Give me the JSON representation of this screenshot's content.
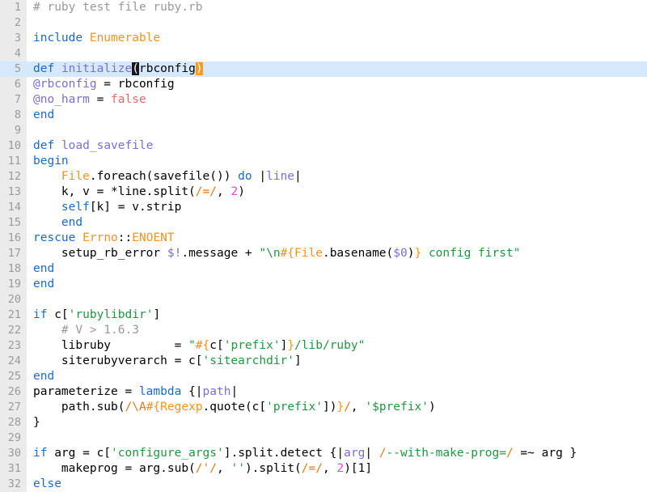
{
  "editor": {
    "language": "ruby",
    "filename": "ruby.rb",
    "current_line": 5,
    "total_lines_visible": 32,
    "colors": {
      "background": "#ffffff",
      "gutter_background": "#ebebeb",
      "line_number": "#9a9a9a",
      "current_line_highlight": "#d6e9fc",
      "keyword": "#1b6ac9",
      "constant": "#f6921e",
      "instance_variable": "#7a6fd4",
      "global_variable": "#7a6fd4",
      "block_variable": "#7a6fd4",
      "string": "#219641",
      "number": "#d94fd4",
      "regex": "#e07b1c",
      "comment": "#999999",
      "plain_text": "#000000",
      "boolean": "#e06c6c",
      "cursor_block": "#18181c",
      "matching_bracket": "#ff9a1e"
    },
    "lines": [
      {
        "number": "1",
        "tokens": [
          {
            "text": "# ruby test file ruby.rb",
            "cls": "t-comment"
          }
        ]
      },
      {
        "number": "2",
        "tokens": []
      },
      {
        "number": "3",
        "tokens": [
          {
            "text": "include",
            "cls": "t-kw"
          },
          {
            "text": " ",
            "cls": "t-plain"
          },
          {
            "text": "Enumerable",
            "cls": "t-const"
          }
        ]
      },
      {
        "number": "4",
        "tokens": []
      },
      {
        "number": "5",
        "current": true,
        "tokens": [
          {
            "text": "def",
            "cls": "t-kw"
          },
          {
            "text": " ",
            "cls": "t-plain"
          },
          {
            "text": "initialize",
            "cls": "t-ivar"
          },
          {
            "text": "(",
            "cls": "cursor-blk"
          },
          {
            "text": "rbconfig",
            "cls": "t-plain"
          },
          {
            "text": ")",
            "cls": "match-brk"
          }
        ]
      },
      {
        "number": "6",
        "tokens": [
          {
            "text": "@rbconfig",
            "cls": "t-ivar"
          },
          {
            "text": " = rbconfig",
            "cls": "t-plain"
          }
        ]
      },
      {
        "number": "7",
        "tokens": [
          {
            "text": "@no_harm",
            "cls": "t-ivar"
          },
          {
            "text": " = ",
            "cls": "t-plain"
          },
          {
            "text": "false",
            "cls": "t-bool"
          }
        ]
      },
      {
        "number": "8",
        "tokens": [
          {
            "text": "end",
            "cls": "t-kw"
          }
        ]
      },
      {
        "number": "9",
        "tokens": []
      },
      {
        "number": "10",
        "tokens": [
          {
            "text": "def",
            "cls": "t-kw"
          },
          {
            "text": " ",
            "cls": "t-plain"
          },
          {
            "text": "load_savefile",
            "cls": "t-ivar"
          }
        ]
      },
      {
        "number": "11",
        "tokens": [
          {
            "text": "begin",
            "cls": "t-kw"
          }
        ]
      },
      {
        "number": "12",
        "tokens": [
          {
            "text": "    ",
            "cls": "t-plain"
          },
          {
            "text": "File",
            "cls": "t-const"
          },
          {
            "text": ".foreach(savefile()) ",
            "cls": "t-plain"
          },
          {
            "text": "do",
            "cls": "t-kw"
          },
          {
            "text": " |",
            "cls": "t-plain"
          },
          {
            "text": "line",
            "cls": "t-blockvar"
          },
          {
            "text": "|",
            "cls": "t-plain"
          }
        ]
      },
      {
        "number": "13",
        "tokens": [
          {
            "text": "    k, v = *line.split(",
            "cls": "t-plain"
          },
          {
            "text": "/=/",
            "cls": "t-regex"
          },
          {
            "text": ", ",
            "cls": "t-plain"
          },
          {
            "text": "2",
            "cls": "t-num"
          },
          {
            "text": ")",
            "cls": "t-plain"
          }
        ]
      },
      {
        "number": "14",
        "tokens": [
          {
            "text": "    ",
            "cls": "t-plain"
          },
          {
            "text": "self",
            "cls": "t-kw"
          },
          {
            "text": "[k] = v.strip",
            "cls": "t-plain"
          }
        ]
      },
      {
        "number": "15",
        "tokens": [
          {
            "text": "    ",
            "cls": "t-plain"
          },
          {
            "text": "end",
            "cls": "t-kw"
          }
        ]
      },
      {
        "number": "16",
        "tokens": [
          {
            "text": "rescue",
            "cls": "t-kw"
          },
          {
            "text": " ",
            "cls": "t-plain"
          },
          {
            "text": "Errno",
            "cls": "t-const"
          },
          {
            "text": "::",
            "cls": "t-plain"
          },
          {
            "text": "ENOENT",
            "cls": "t-const"
          }
        ]
      },
      {
        "number": "17",
        "tokens": [
          {
            "text": "    setup_rb_error ",
            "cls": "t-plain"
          },
          {
            "text": "$!",
            "cls": "t-gvar"
          },
          {
            "text": ".message + ",
            "cls": "t-plain"
          },
          {
            "text": "\"\\n",
            "cls": "t-str"
          },
          {
            "text": "#{",
            "cls": "t-interp"
          },
          {
            "text": "File",
            "cls": "t-const"
          },
          {
            "text": ".basename(",
            "cls": "t-plain"
          },
          {
            "text": "$0",
            "cls": "t-gvar"
          },
          {
            "text": ")",
            "cls": "t-plain"
          },
          {
            "text": "}",
            "cls": "t-interp"
          },
          {
            "text": " config first\"",
            "cls": "t-str"
          }
        ]
      },
      {
        "number": "18",
        "tokens": [
          {
            "text": "end",
            "cls": "t-kw"
          }
        ]
      },
      {
        "number": "19",
        "tokens": [
          {
            "text": "end",
            "cls": "t-kw"
          }
        ]
      },
      {
        "number": "20",
        "tokens": []
      },
      {
        "number": "21",
        "tokens": [
          {
            "text": "if",
            "cls": "t-kw"
          },
          {
            "text": " c[",
            "cls": "t-plain"
          },
          {
            "text": "'rubylibdir'",
            "cls": "t-str"
          },
          {
            "text": "]",
            "cls": "t-plain"
          }
        ]
      },
      {
        "number": "22",
        "tokens": [
          {
            "text": "    ",
            "cls": "t-plain"
          },
          {
            "text": "# V > 1.6.3",
            "cls": "t-comment"
          }
        ]
      },
      {
        "number": "23",
        "tokens": [
          {
            "text": "    libruby         = ",
            "cls": "t-plain"
          },
          {
            "text": "\"",
            "cls": "t-str"
          },
          {
            "text": "#{",
            "cls": "t-interp"
          },
          {
            "text": "c[",
            "cls": "t-plain"
          },
          {
            "text": "'prefix'",
            "cls": "t-str"
          },
          {
            "text": "]",
            "cls": "t-plain"
          },
          {
            "text": "}",
            "cls": "t-interp"
          },
          {
            "text": "/lib/ruby\"",
            "cls": "t-str"
          }
        ]
      },
      {
        "number": "24",
        "tokens": [
          {
            "text": "    siterubyverarch = c[",
            "cls": "t-plain"
          },
          {
            "text": "'sitearchdir'",
            "cls": "t-str"
          },
          {
            "text": "]",
            "cls": "t-plain"
          }
        ]
      },
      {
        "number": "25",
        "tokens": [
          {
            "text": "end",
            "cls": "t-kw"
          }
        ]
      },
      {
        "number": "26",
        "tokens": [
          {
            "text": "parameterize = ",
            "cls": "t-plain"
          },
          {
            "text": "lambda",
            "cls": "t-kw"
          },
          {
            "text": " {|",
            "cls": "t-plain"
          },
          {
            "text": "path",
            "cls": "t-blockvar"
          },
          {
            "text": "|",
            "cls": "t-plain"
          }
        ]
      },
      {
        "number": "27",
        "tokens": [
          {
            "text": "    path.sub(",
            "cls": "t-plain"
          },
          {
            "text": "/\\A",
            "cls": "t-regex"
          },
          {
            "text": "#{",
            "cls": "t-interp"
          },
          {
            "text": "Regexp",
            "cls": "t-const"
          },
          {
            "text": ".quote(c[",
            "cls": "t-plain"
          },
          {
            "text": "'prefix'",
            "cls": "t-str"
          },
          {
            "text": "])",
            "cls": "t-plain"
          },
          {
            "text": "}",
            "cls": "t-interp"
          },
          {
            "text": "/",
            "cls": "t-regex"
          },
          {
            "text": ", ",
            "cls": "t-plain"
          },
          {
            "text": "'$prefix'",
            "cls": "t-str"
          },
          {
            "text": ")",
            "cls": "t-plain"
          }
        ]
      },
      {
        "number": "28",
        "tokens": [
          {
            "text": "}",
            "cls": "t-plain"
          }
        ]
      },
      {
        "number": "29",
        "tokens": []
      },
      {
        "number": "30",
        "tokens": [
          {
            "text": "if",
            "cls": "t-kw"
          },
          {
            "text": " arg = c[",
            "cls": "t-plain"
          },
          {
            "text": "'configure_args'",
            "cls": "t-str"
          },
          {
            "text": "].split.detect {|",
            "cls": "t-plain"
          },
          {
            "text": "arg",
            "cls": "t-blockvar"
          },
          {
            "text": "| ",
            "cls": "t-plain"
          },
          {
            "text": "/",
            "cls": "t-regex"
          },
          {
            "text": "--with-make-prog=",
            "cls": "t-str"
          },
          {
            "text": "/",
            "cls": "t-regex"
          },
          {
            "text": " =~ arg }",
            "cls": "t-plain"
          }
        ]
      },
      {
        "number": "31",
        "tokens": [
          {
            "text": "    makeprog = arg.sub(",
            "cls": "t-plain"
          },
          {
            "text": "/'/",
            "cls": "t-regex"
          },
          {
            "text": ", ",
            "cls": "t-plain"
          },
          {
            "text": "''",
            "cls": "t-str"
          },
          {
            "text": ").split(",
            "cls": "t-plain"
          },
          {
            "text": "/=/",
            "cls": "t-regex"
          },
          {
            "text": ", ",
            "cls": "t-plain"
          },
          {
            "text": "2",
            "cls": "t-num"
          },
          {
            "text": ")[1]",
            "cls": "t-plain"
          }
        ]
      },
      {
        "number": "32",
        "tokens": [
          {
            "text": "else",
            "cls": "t-kw"
          }
        ]
      }
    ]
  }
}
